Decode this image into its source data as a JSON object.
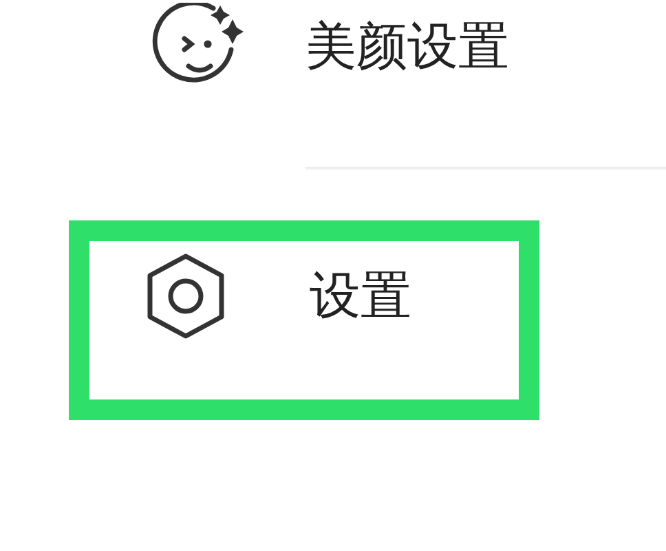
{
  "menu_items": [
    {
      "kind": "beauty",
      "label": "美颜设置",
      "highlighted": false
    },
    {
      "kind": "settings",
      "label": "设置",
      "highlighted": true
    }
  ]
}
